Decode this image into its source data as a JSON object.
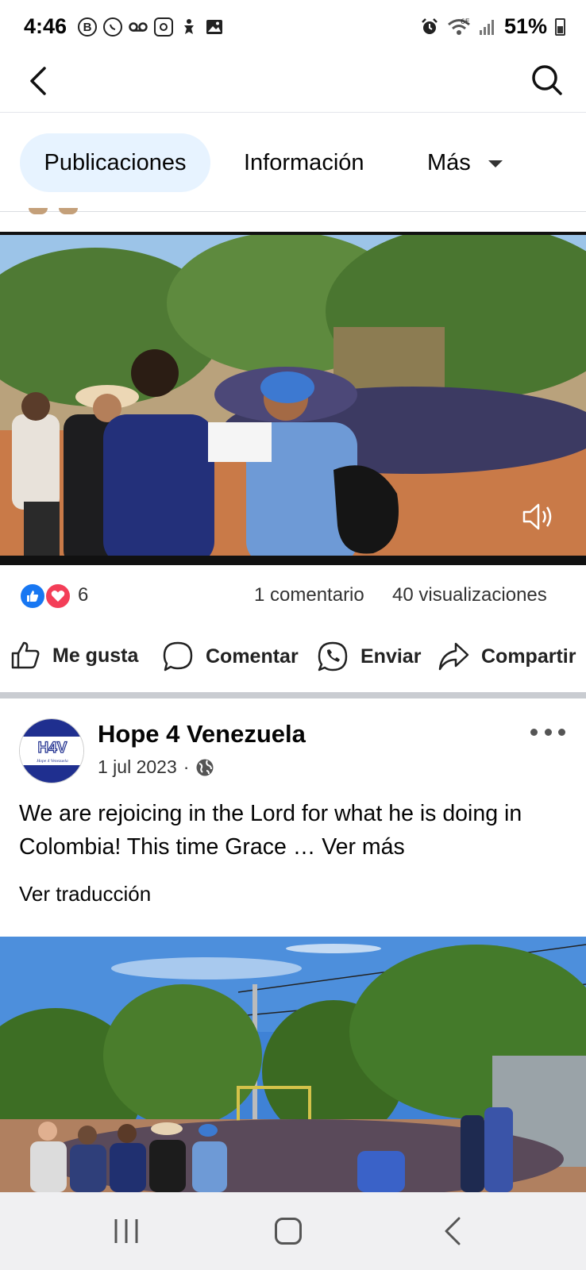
{
  "status_bar": {
    "time": "4:46",
    "left_icons": [
      "b-icon",
      "whatsapp-icon",
      "voicemail-icon",
      "instagram-icon",
      "accessibility-icon",
      "image-icon"
    ],
    "right_icons": [
      "alarm-icon",
      "wifi-6e-icon",
      "signal-icon"
    ],
    "battery": "51%"
  },
  "nav": {
    "back_icon": "chevron-left-icon",
    "search_icon": "search-icon"
  },
  "tabs": {
    "publicaciones": "Publicaciones",
    "informacion": "Información",
    "mas": "Más"
  },
  "video_post": {
    "reaction_count": "6",
    "comments": "1 comentario",
    "views": "40 visualizaciones"
  },
  "actions": {
    "like": "Me gusta",
    "comment": "Comentar",
    "send": "Enviar",
    "share": "Compartir"
  },
  "post": {
    "author": "Hope 4 Venezuela",
    "avatar_text": "H4V",
    "avatar_subtext": "Hope 4 Venezuela",
    "date": "1 jul 2023",
    "separator": "·",
    "text": "We are rejoicing in the Lord for what he is doing in Colombia! This time Grace … ",
    "see_more": "Ver más",
    "translate": "Ver traducción"
  },
  "colors": {
    "accent": "#1877f2",
    "love": "#f33e58",
    "active_tab_bg": "#e7f3ff"
  }
}
